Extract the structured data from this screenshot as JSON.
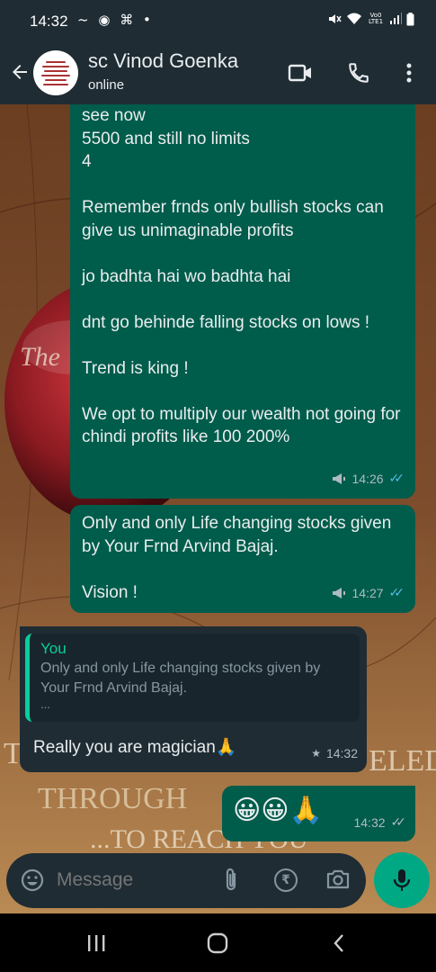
{
  "status_bar": {
    "time": "14:32",
    "left_icons": "~ ◉ ⌘ •",
    "network": "Vo0 LTE1"
  },
  "header": {
    "contact_name": "sc Vinod Goenka",
    "contact_status": "online",
    "icons": [
      "back-arrow-icon",
      "video-call-icon",
      "phone-icon",
      "more-vert-icon"
    ]
  },
  "messages": [
    {
      "direction": "outgoing",
      "text": "see now\n5500 and still no limits\n4\n\nRemember frnds only bullish stocks can give us unimaginable profits\n\njo badhta hai wo badhta hai\n\ndnt go behinde falling stocks on lows !\n\nTrend is king !\n\nWe opt to multiply our wealth not going for chindi profits like 100 200%",
      "time": "14:26",
      "status": "read"
    },
    {
      "direction": "outgoing",
      "text": "Only and only Life changing stocks given by Your Frnd Arvind Bajaj.\n\nVision !",
      "time": "14:27",
      "status": "read"
    },
    {
      "direction": "incoming",
      "quote": {
        "author": "You",
        "text": "Only and only Life changing stocks given by Your Frnd Arvind Bajaj.",
        "ellipsis": "..."
      },
      "text": "Really you are magician🙏",
      "time": "14:32",
      "starred": true
    },
    {
      "direction": "outgoing",
      "text": "😀😀🙏",
      "time": "14:32",
      "status": "delivered"
    }
  ],
  "wallpaper_text": {
    "the": "The",
    "line1": "T",
    "line1_right": "ELED",
    "line2": "THROUGH",
    "line3": "...TO REACH YOU"
  },
  "input": {
    "placeholder": "Message"
  },
  "colors": {
    "header_bg": "#1f2c34",
    "outgoing_bubble": "#005c4b",
    "incoming_bubble": "#1f2c34",
    "accent": "#00a884",
    "read_ticks": "#53bdeb"
  }
}
